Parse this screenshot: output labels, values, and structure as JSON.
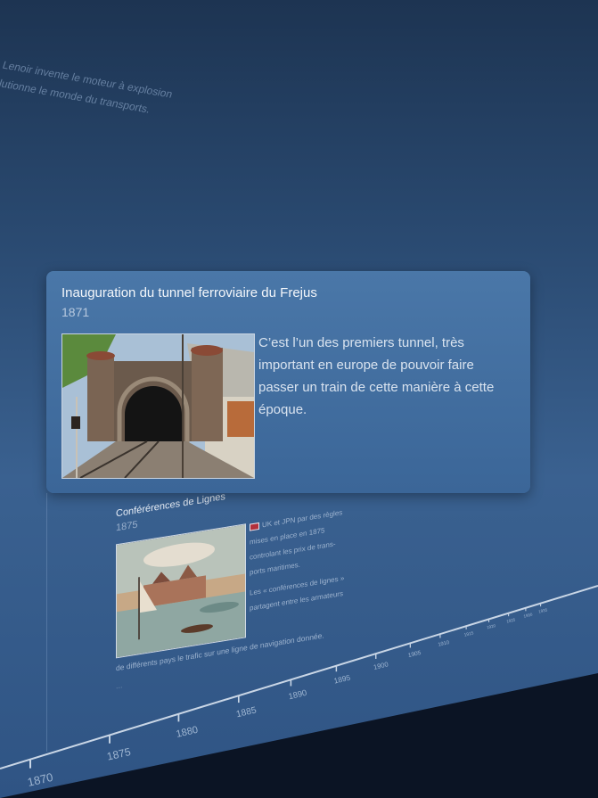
{
  "background_event": {
    "line1": "ne Lenoir invente le moteur à explosion",
    "line2": "évolutionne le monde du transports."
  },
  "main_event": {
    "title": "Inauguration du tunnel ferroviaire du Frejus",
    "year": "1871",
    "description": "C’est l’un des premiers tunnel, très important en europe de pouvoir faire passer un train de cette manière à cette époque.",
    "image_icon": "railway-tunnel-photo"
  },
  "secondary_event": {
    "title": "Conférérences de Lignes",
    "year": "1875",
    "text1": "UK et JPN par des règles mises en place en 1875 controlant les prix de trans- ports maritimes.",
    "text2": "Les « conférences de lignes » partagent entre les armateurs",
    "text3": "de différents pays le trafic sur une ligne de navigation donnée.",
    "more": "...",
    "flag_icon": "uk-flag-icon",
    "image_icon": "harbor-painting"
  },
  "timeline": {
    "ticks": [
      "1870",
      "1875",
      "1880",
      "1885",
      "1890",
      "1895",
      "1900",
      "1905",
      "1910",
      "1915",
      "1920",
      "1925",
      "1930",
      "1935"
    ]
  },
  "colors": {
    "card_bg": "#4a77a8",
    "axis_line": "#c9d6e6",
    "tick_label": "#9fb6d2"
  }
}
